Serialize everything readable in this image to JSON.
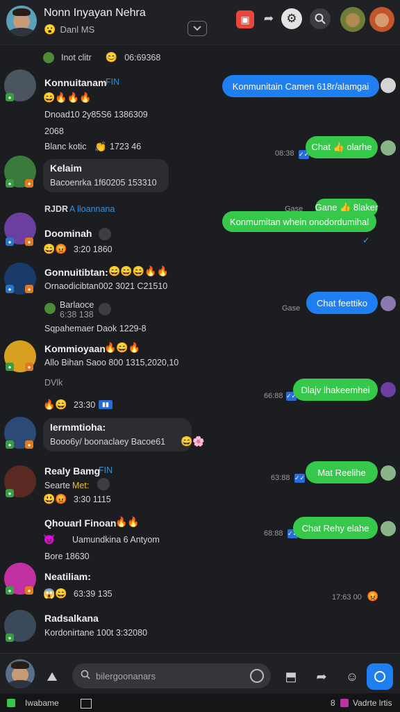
{
  "header": {
    "title": "Nonn Inyayan Nehra",
    "subtitle": "Danl MS",
    "status_emoji": "😮"
  },
  "chat": {
    "top_line": {
      "left": "Inot clitr",
      "right": "06:69368"
    },
    "messages": [
      {
        "name": "Konnuitanam",
        "tag": "FIN",
        "emojis": "😄🔥🔥🔥",
        "line1": "Dnoad10 2y85S6 1386309",
        "line2": "2068",
        "line3": "Blanc kotic",
        "line3_emoji": "👏",
        "line3_time": "1723 46"
      },
      {
        "name": "Kelaim",
        "line1": "Bacoenrka 1f60205 153310"
      },
      {
        "header": "RJDR",
        "header_tag": "A lloannana",
        "name": "Doominah",
        "time": "3:20 1860"
      },
      {
        "name": "Gonnuitibtan:",
        "emojis": "😄😄😄🔥🔥",
        "line1": "Ornaodicibtan002 3021 C21510",
        "line2": "Barlaoce",
        "line2_time": "6:38 138",
        "line3": "Sqpahemaer Daok 1229-8"
      },
      {
        "name": "Kommioyaan",
        "emojis": "🔥😄🔥",
        "line1": "Allo Bihan Saoo 800 1315,2020,10",
        "line2": "DVlk",
        "time": "23:30"
      },
      {
        "name": "Iermmtioha:",
        "line1": "Booo6y/ boonaclaey Bacoe61"
      },
      {
        "name": "Realy Bamg",
        "tag": "FIN",
        "line1": "Searte",
        "line1_tag": "Met:",
        "time": "3:30 1115"
      },
      {
        "name": "Qhouarl Finoan",
        "line1": "Uamundkina 6 Antyom",
        "line2": "Bore 18630"
      },
      {
        "name": "Neatiliam:",
        "time": "63:39 135"
      },
      {
        "name": "Radsalkana",
        "line1": "Kordonirtane 100t 3:32080"
      }
    ],
    "outgoing": [
      {
        "text": "Konmunitain Camen 618r/alamgai",
        "color": "blue"
      },
      {
        "text": "Chat 👍 olarhe",
        "color": "green",
        "time": "08:38"
      },
      {
        "text": "Gane 👍 8laker",
        "color": "green",
        "time": "Gase"
      },
      {
        "text": "Konmumitan whein onodordumihal",
        "color": "green"
      },
      {
        "text": "Chat feettiko",
        "color": "blue",
        "time": "Gase"
      },
      {
        "text": "Dlajv lhakeemhei",
        "color": "green",
        "time": "66:88"
      },
      {
        "text": "Mat Reelihe",
        "color": "green",
        "time": "63:88"
      },
      {
        "text": "Chat Rehy elahe",
        "color": "green",
        "time": "68:88"
      }
    ],
    "last_time": "17:63 00"
  },
  "footer": {
    "search_placeholder": "bilergoonanars",
    "status_left": "Iwabame",
    "status_right_num": "8",
    "status_right": "Vadrte lrtis"
  },
  "colors": {
    "blue": "#1f7ef0",
    "green": "#35c84a",
    "bg": "#1c1d20"
  }
}
